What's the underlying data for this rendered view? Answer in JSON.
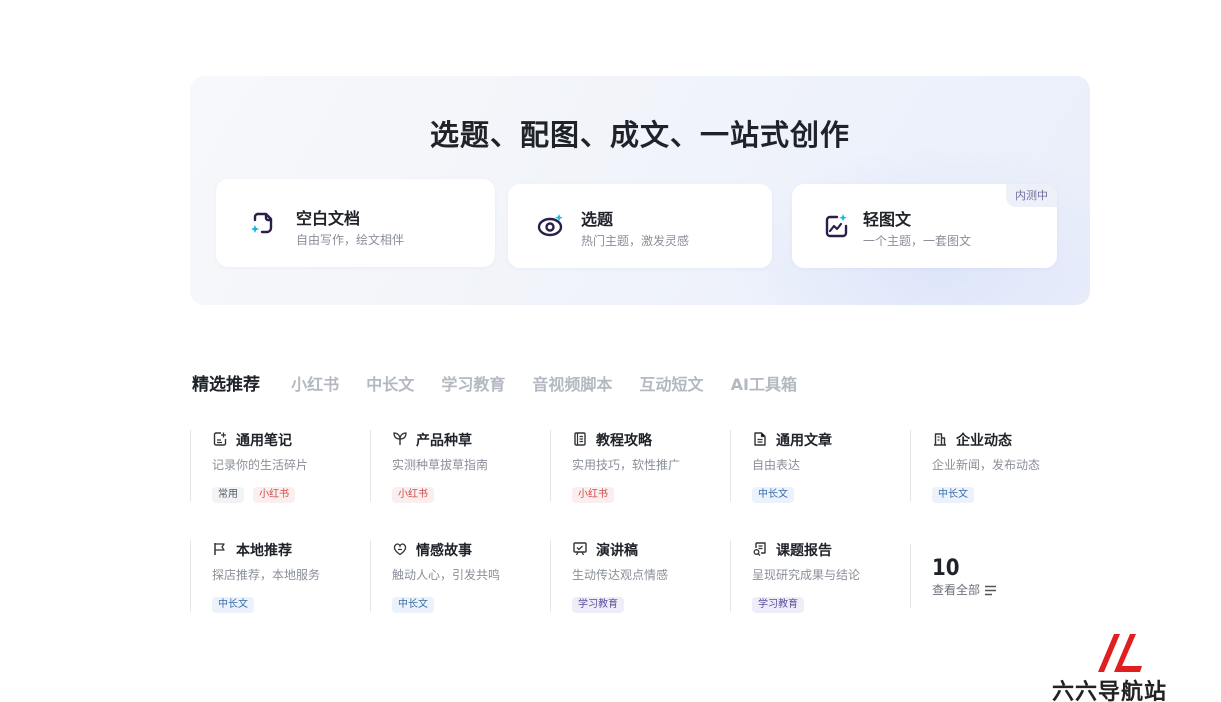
{
  "hero": {
    "title": "选题、配图、成文、一站式创作",
    "cards": [
      {
        "title": "空白文档",
        "desc": "自由写作，绘文相伴",
        "icon": "blank-doc-icon"
      },
      {
        "title": "选题",
        "desc": "热门主题，激发灵感",
        "icon": "topic-eye-icon"
      },
      {
        "title": "轻图文",
        "desc": "一个主题，一套图文",
        "icon": "image-text-icon",
        "badge": "内测中"
      }
    ]
  },
  "tabs": [
    "精选推荐",
    "小红书",
    "中长文",
    "学习教育",
    "音视频脚本",
    "互动短文",
    "AI工具箱"
  ],
  "templates": [
    {
      "title": "通用笔记",
      "desc": "记录你的生活碎片",
      "icon": "note-edit-icon",
      "tags": [
        {
          "label": "常用",
          "tone": "gray"
        },
        {
          "label": "小红书",
          "tone": "red"
        }
      ]
    },
    {
      "title": "产品种草",
      "desc": "实测种草拔草指南",
      "icon": "sprout-icon",
      "tags": [
        {
          "label": "小红书",
          "tone": "red"
        }
      ]
    },
    {
      "title": "教程攻略",
      "desc": "实用技巧，软性推广",
      "icon": "book-icon",
      "tags": [
        {
          "label": "小红书",
          "tone": "red"
        }
      ]
    },
    {
      "title": "通用文章",
      "desc": "自由表达",
      "icon": "document-icon",
      "tags": [
        {
          "label": "中长文",
          "tone": "blue"
        }
      ]
    },
    {
      "title": "企业动态",
      "desc": "企业新闻，发布动态",
      "icon": "building-icon",
      "tags": [
        {
          "label": "中长文",
          "tone": "blue"
        }
      ]
    },
    {
      "title": "本地推荐",
      "desc": "探店推荐，本地服务",
      "icon": "flag-icon",
      "tags": [
        {
          "label": "中长文",
          "tone": "blue"
        }
      ]
    },
    {
      "title": "情感故事",
      "desc": "触动人心，引发共鸣",
      "icon": "heart-story-icon",
      "tags": [
        {
          "label": "中长文",
          "tone": "blue"
        }
      ]
    },
    {
      "title": "演讲稿",
      "desc": "生动传达观点情感",
      "icon": "speech-board-icon",
      "tags": [
        {
          "label": "学习教育",
          "tone": "purple"
        }
      ]
    },
    {
      "title": "课题报告",
      "desc": "呈现研究成果与结论",
      "icon": "report-icon",
      "tags": [
        {
          "label": "学习教育",
          "tone": "purple"
        }
      ]
    }
  ],
  "view_all": {
    "count": "10",
    "label": "查看全部"
  },
  "watermark": {
    "text": "六六导航站"
  },
  "colors": {
    "accent_cyan": "#1fb6e0",
    "icon_dark": "#2b1f4a",
    "logo_red": "#e02020"
  }
}
